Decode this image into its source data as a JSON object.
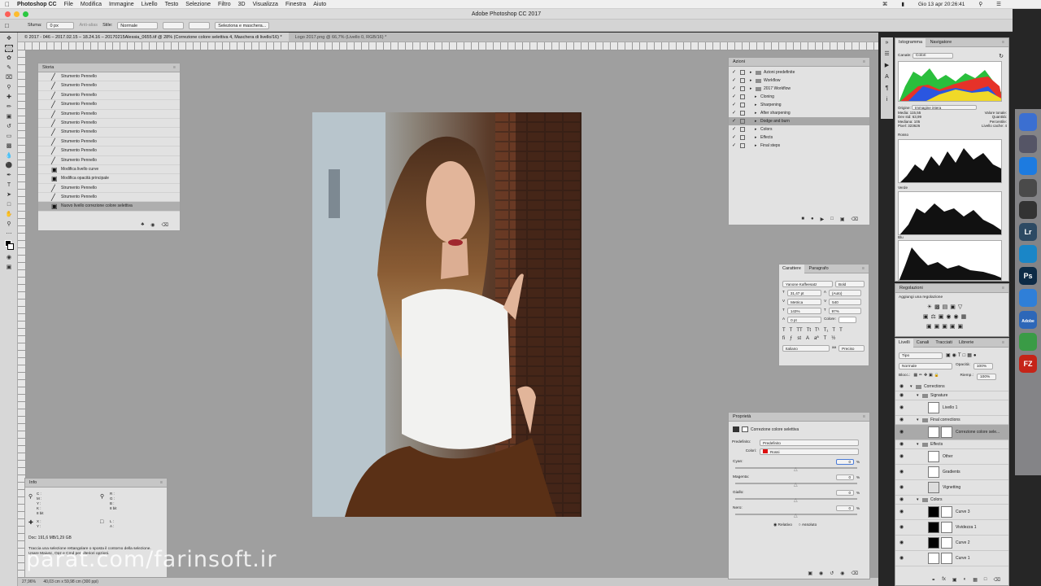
{
  "menubar": {
    "app": "Photoshop CC",
    "items": [
      "File",
      "Modifica",
      "Immagine",
      "Livello",
      "Testo",
      "Selezione",
      "Filtro",
      "3D",
      "Visualizza",
      "Finestra",
      "Aiuto"
    ],
    "clock": "Gio 13 apr  20:26:41"
  },
  "window": {
    "title": "Adobe Photoshop CC 2017"
  },
  "options": {
    "sfuma_label": "Sfuma:",
    "sfuma_value": "0 px",
    "antialias": "Anti-alias",
    "stile_label": "Stile:",
    "stile_value": "Normale",
    "button": "Seleziona e maschera..."
  },
  "doc_tabs": [
    "© 2017 - 046 – 2017.02.15 – 18.24.16 – 20170215Alessia_0655.tif @ 28% (Correzione colore selettiva 4, Maschera di livello/16) *",
    "Logo 2017.png @ 66,7% (Livello 0, RGB/16) *"
  ],
  "status": {
    "zoom": "27,96%",
    "doc_size": "40,03 cm x 59,98 cm (300 ppi)"
  },
  "history": {
    "title": "Storia",
    "items": [
      "Strumento Pennello",
      "Strumento Pennello",
      "Strumento Pennello",
      "Strumento Pennello",
      "Strumento Pennello",
      "Strumento Pennello",
      "Strumento Pennello",
      "Strumento Pennello",
      "Strumento Pennello",
      "Strumento Pennello",
      "Modifica livello curve",
      "Modifica opacità principale",
      "Strumento Pennello",
      "Strumento Pennello",
      "Nuovo livello correzione colore selettiva"
    ]
  },
  "info": {
    "title": "Info",
    "c": "C :",
    "m": "M :",
    "y": "Y :",
    "k": "K :",
    "r": "R :",
    "g": "G :",
    "b": "B :",
    "bit8a": "8 bit",
    "bit8b": "8 bit",
    "x": "X :",
    "yy": "Y :",
    "w": "L :",
    "h": "A :",
    "doc": "Doc: 191,6 MB/1,29 GB",
    "hint": "Traccia una selezione rettangolare o sposta il contorno della selezione. Usare Maiusc, Opz e Cmd per ulteriori opzioni."
  },
  "actions": {
    "title": "Azioni",
    "items": [
      {
        "label": "Azioni predefinite",
        "lvl": 0,
        "folder": true
      },
      {
        "label": "Workflow",
        "lvl": 0,
        "folder": true
      },
      {
        "label": "2017 Workflow",
        "lvl": 0,
        "folder": true
      },
      {
        "label": "Cloning",
        "lvl": 1
      },
      {
        "label": "Sharpening",
        "lvl": 1
      },
      {
        "label": "After sharpening",
        "lvl": 1
      },
      {
        "label": "Dodge and burn",
        "lvl": 1,
        "sel": true
      },
      {
        "label": "Colors",
        "lvl": 1
      },
      {
        "label": "Effects",
        "lvl": 1
      },
      {
        "label": "Final steps",
        "lvl": 1
      }
    ]
  },
  "character": {
    "tab1": "Carattere",
    "tab2": "Paragrafo",
    "font": "Yanone Kaffeesatz",
    "style": "Bold",
    "size": "31,47 pt",
    "leading": "(Auto)",
    "kern": "Metrica",
    "track": "540",
    "vscale": "143%",
    "hscale": "97%",
    "baseline": "0 pt",
    "color_label": "Colore:",
    "lang": "Italiano",
    "aa": "Preciso"
  },
  "properties": {
    "title": "Proprietà",
    "name": "Correzione colore selettiva",
    "preset_label": "Predefinito:",
    "preset": "Predefinito",
    "colors_label": "Colori:",
    "color": "Rossi",
    "cyan": "Cyan:",
    "cyan_v": "0",
    "magenta": "Magenta:",
    "magenta_v": "0",
    "giallo": "Giallo:",
    "giallo_v": "0",
    "nero": "Nero:",
    "nero_v": "0",
    "pct": "%",
    "rel": "Relativo",
    "abs": "Assoluto"
  },
  "histogram": {
    "tab1": "Istogramma",
    "tab2": "Navigatore",
    "canale_label": "Canale:",
    "canale": "Colori",
    "origine_label": "Origine:",
    "origine": "Immagine intera",
    "media": "Media:",
    "media_v": "115,55",
    "devst": "Dev std:",
    "devst_v": "63,99",
    "mediana": "Mediana:",
    "mediana_v": "105",
    "pixel": "Pixel:",
    "pixel_v": "323626",
    "val": "Valore tonale:",
    "qty": "Quantità:",
    "perc": "Percentile:",
    "cache": "Livello cache:",
    "cache_v": "4",
    "rosso": "Rosso",
    "verde": "Verde",
    "blu": "Blu"
  },
  "adjustments": {
    "title": "Regolazioni",
    "add": "Aggiungi una regolazione"
  },
  "layers": {
    "tabs": [
      "Livelli",
      "Canali",
      "Tracciati",
      "Librerie"
    ],
    "kind": "Tipo",
    "mode": "Normale",
    "opacity_label": "Opacità:",
    "opacity": "100%",
    "lock_label": "Blocc.:",
    "fill_label": "Riemp.:",
    "fill": "100%",
    "items": [
      {
        "name": "Corrections",
        "lvl": 0,
        "group": true
      },
      {
        "name": "Signature",
        "lvl": 1,
        "group": true
      },
      {
        "name": "Livello 1",
        "lvl": 2
      },
      {
        "name": "Final corrections",
        "lvl": 1,
        "group": true
      },
      {
        "name": "Correzione colore sele...",
        "lvl": 2,
        "sel": true
      },
      {
        "name": "Effects",
        "lvl": 1,
        "group": true
      },
      {
        "name": "Other",
        "lvl": 2
      },
      {
        "name": "Gradients",
        "lvl": 2
      },
      {
        "name": "Vignetting",
        "lvl": 2
      },
      {
        "name": "Colors",
        "lvl": 1,
        "group": true
      },
      {
        "name": "Curve 3",
        "lvl": 2
      },
      {
        "name": "Vividezza 1",
        "lvl": 2
      },
      {
        "name": "Curve 2",
        "lvl": 2
      },
      {
        "name": "Curve 1",
        "lvl": 2
      }
    ]
  },
  "dock": [
    {
      "label": "",
      "c": "#3b6fd1"
    },
    {
      "label": "",
      "c": "#556"
    },
    {
      "label": "",
      "c": "#1d7be0"
    },
    {
      "label": "",
      "c": "#4a4a4a"
    },
    {
      "label": "",
      "c": "#333"
    },
    {
      "label": "Lr",
      "c": "#2d4a63"
    },
    {
      "label": "",
      "c": "#1a86c7"
    },
    {
      "label": "Ps",
      "c": "#0d2b46"
    },
    {
      "label": "",
      "c": "#2f7fd8"
    },
    {
      "label": "Adobe",
      "c": "#2d67b8"
    },
    {
      "label": "",
      "c": "#3a9b46"
    },
    {
      "label": "FZ",
      "c": "#c52418"
    }
  ],
  "watermark": "parat.com/farinsoft.ir"
}
